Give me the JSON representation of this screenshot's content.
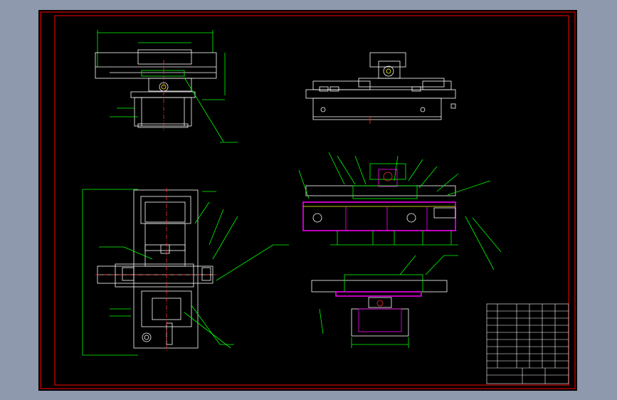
{
  "app": {
    "title": ""
  },
  "drawing": {
    "background": "#000000",
    "frame_color": "#ff0000",
    "line_colors": {
      "outline": "#ffffff",
      "dimension": "#00ff00",
      "leader": "#00ff00",
      "centerline": "#ff3030",
      "section": "#ff00ff",
      "hatch": "#ffff00"
    },
    "views": [
      {
        "id": "front-view"
      },
      {
        "id": "side-view"
      },
      {
        "id": "plan-view"
      },
      {
        "id": "section-view"
      },
      {
        "id": "detail-view"
      }
    ],
    "title_block": {
      "rows": 11,
      "cols": 6
    }
  }
}
